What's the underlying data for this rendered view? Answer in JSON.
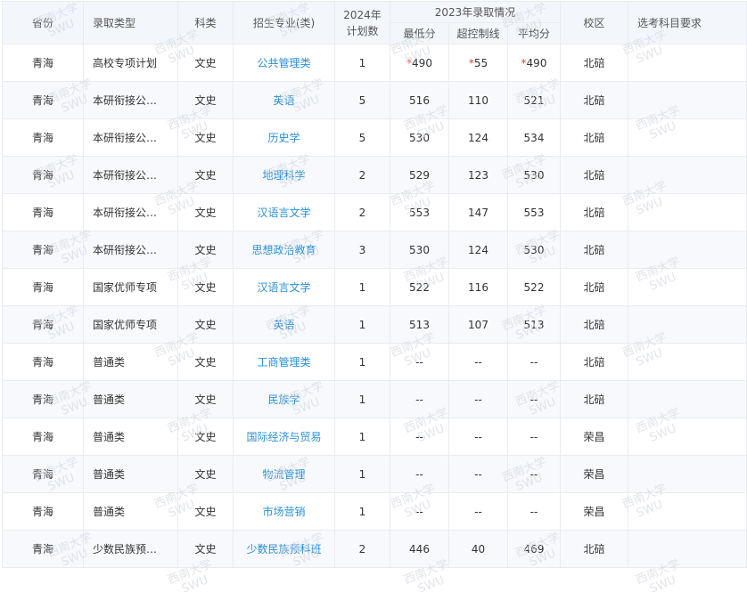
{
  "watermark": {
    "line1": "西南大学",
    "line2": "SWU"
  },
  "headers": {
    "province": "省份",
    "type": "录取类型",
    "subject": "科类",
    "major": "招生专业(类)",
    "plan_line1": "2024年",
    "plan_line2": "计划数",
    "prev_group": "2023年录取情况",
    "min": "最低分",
    "over": "超控制线",
    "avg": "平均分",
    "campus": "校区",
    "req": "选考科目要求"
  },
  "rows": [
    {
      "province": "青海",
      "type": "高校专项计划",
      "subject": "文史",
      "major": "公共管理类",
      "plan": "1",
      "min": "490",
      "min_star": "*",
      "over": "55",
      "over_star": "*",
      "avg": "490",
      "avg_star": "*",
      "campus": "北碚",
      "req": ""
    },
    {
      "province": "青海",
      "type": "本研衔接公…",
      "subject": "文史",
      "major": "英语",
      "plan": "5",
      "min": "516",
      "min_star": "",
      "over": "110",
      "over_star": "",
      "avg": "521",
      "avg_star": "",
      "campus": "北碚",
      "req": ""
    },
    {
      "province": "青海",
      "type": "本研衔接公…",
      "subject": "文史",
      "major": "历史学",
      "plan": "5",
      "min": "530",
      "min_star": "",
      "over": "124",
      "over_star": "",
      "avg": "534",
      "avg_star": "",
      "campus": "北碚",
      "req": ""
    },
    {
      "province": "青海",
      "type": "本研衔接公…",
      "subject": "文史",
      "major": "地理科学",
      "plan": "2",
      "min": "529",
      "min_star": "",
      "over": "123",
      "over_star": "",
      "avg": "530",
      "avg_star": "",
      "campus": "北碚",
      "req": ""
    },
    {
      "province": "青海",
      "type": "本研衔接公…",
      "subject": "文史",
      "major": "汉语言文学",
      "plan": "2",
      "min": "553",
      "min_star": "",
      "over": "147",
      "over_star": "",
      "avg": "553",
      "avg_star": "",
      "campus": "北碚",
      "req": ""
    },
    {
      "province": "青海",
      "type": "本研衔接公…",
      "subject": "文史",
      "major": "思想政治教育",
      "plan": "3",
      "min": "530",
      "min_star": "",
      "over": "124",
      "over_star": "",
      "avg": "530",
      "avg_star": "",
      "campus": "北碚",
      "req": ""
    },
    {
      "province": "青海",
      "type": "国家优师专项",
      "subject": "文史",
      "major": "汉语言文学",
      "plan": "1",
      "min": "522",
      "min_star": "",
      "over": "116",
      "over_star": "",
      "avg": "522",
      "avg_star": "",
      "campus": "北碚",
      "req": ""
    },
    {
      "province": "青海",
      "type": "国家优师专项",
      "subject": "文史",
      "major": "英语",
      "plan": "1",
      "min": "513",
      "min_star": "",
      "over": "107",
      "over_star": "",
      "avg": "513",
      "avg_star": "",
      "campus": "北碚",
      "req": ""
    },
    {
      "province": "青海",
      "type": "普通类",
      "subject": "文史",
      "major": "工商管理类",
      "plan": "1",
      "min": "--",
      "min_star": "",
      "over": "--",
      "over_star": "",
      "avg": "--",
      "avg_star": "",
      "campus": "北碚",
      "req": ""
    },
    {
      "province": "青海",
      "type": "普通类",
      "subject": "文史",
      "major": "民族学",
      "plan": "1",
      "min": "--",
      "min_star": "",
      "over": "--",
      "over_star": "",
      "avg": "--",
      "avg_star": "",
      "campus": "北碚",
      "req": ""
    },
    {
      "province": "青海",
      "type": "普通类",
      "subject": "文史",
      "major": "国际经济与贸易",
      "plan": "1",
      "min": "--",
      "min_star": "",
      "over": "--",
      "over_star": "",
      "avg": "--",
      "avg_star": "",
      "campus": "荣昌",
      "req": ""
    },
    {
      "province": "青海",
      "type": "普通类",
      "subject": "文史",
      "major": "物流管理",
      "plan": "1",
      "min": "--",
      "min_star": "",
      "over": "--",
      "over_star": "",
      "avg": "--",
      "avg_star": "",
      "campus": "荣昌",
      "req": ""
    },
    {
      "province": "青海",
      "type": "普通类",
      "subject": "文史",
      "major": "市场营销",
      "plan": "1",
      "min": "--",
      "min_star": "",
      "over": "--",
      "over_star": "",
      "avg": "--",
      "avg_star": "",
      "campus": "荣昌",
      "req": ""
    },
    {
      "province": "青海",
      "type": "少数民族预…",
      "subject": "文史",
      "major": "少数民族预科班",
      "plan": "2",
      "min": "446",
      "min_star": "",
      "over": "40",
      "over_star": "",
      "avg": "469",
      "avg_star": "",
      "campus": "北碚",
      "req": ""
    }
  ]
}
